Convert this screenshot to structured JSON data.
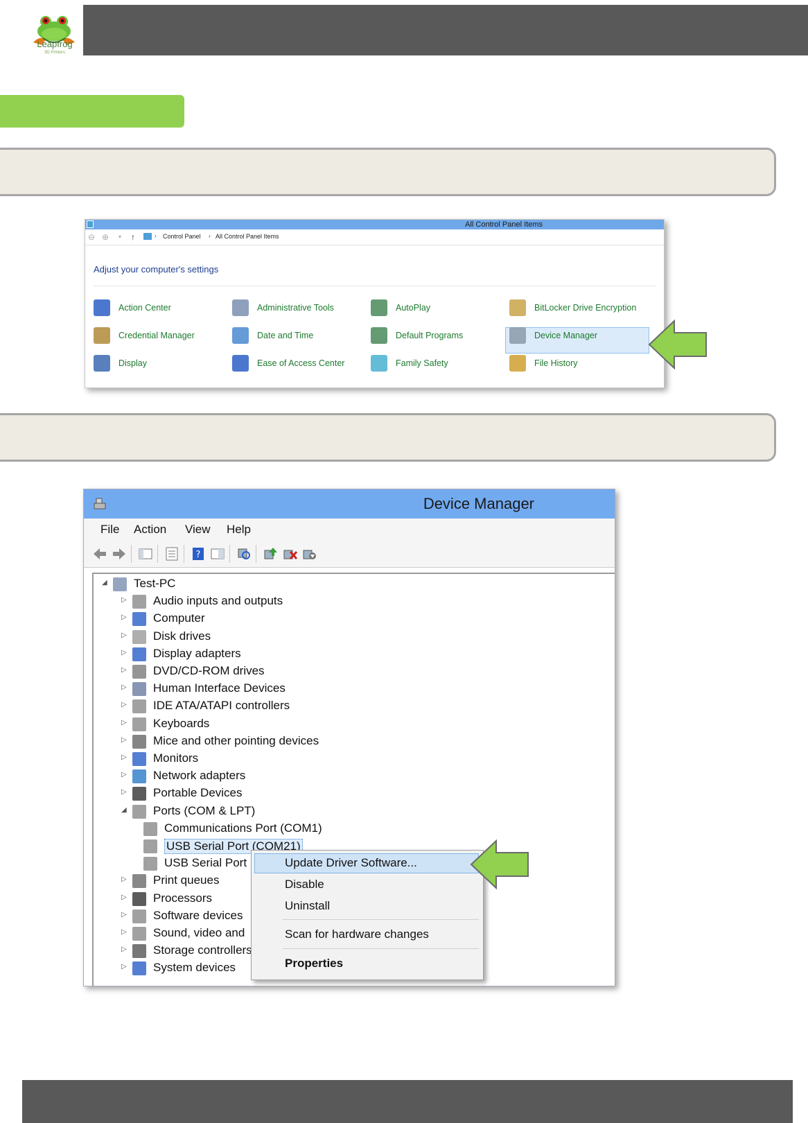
{
  "brand": {
    "name": "Leapfrog",
    "sub": "3D Printers"
  },
  "control_panel": {
    "title": "All Control Panel Items",
    "breadcrumb": [
      "Control Panel",
      "All Control Panel Items"
    ],
    "heading": "Adjust your computer's settings",
    "items": [
      {
        "label": "Action Center",
        "icon": "flag-icon"
      },
      {
        "label": "Administrative Tools",
        "icon": "admin-tools-icon"
      },
      {
        "label": "AutoPlay",
        "icon": "autoplay-icon"
      },
      {
        "label": "BitLocker Drive Encryption",
        "icon": "bitlocker-icon"
      },
      {
        "label": "Credential Manager",
        "icon": "credential-icon"
      },
      {
        "label": "Date and Time",
        "icon": "clock-icon"
      },
      {
        "label": "Default Programs",
        "icon": "default-programs-icon"
      },
      {
        "label": "Device Manager",
        "icon": "device-manager-icon"
      },
      {
        "label": "Display",
        "icon": "display-icon"
      },
      {
        "label": "Ease of Access Center",
        "icon": "ease-access-icon"
      },
      {
        "label": "Family Safety",
        "icon": "family-icon"
      },
      {
        "label": "File History",
        "icon": "file-history-icon"
      }
    ],
    "selected": "Device Manager"
  },
  "device_manager": {
    "title": "Device Manager",
    "menu": [
      "File",
      "Action",
      "View",
      "Help"
    ],
    "tree": [
      {
        "label": "Test-PC",
        "state": "expanded"
      },
      {
        "label": "Audio inputs and outputs",
        "state": "collapsed"
      },
      {
        "label": "Computer",
        "state": "collapsed"
      },
      {
        "label": "Disk drives",
        "state": "collapsed"
      },
      {
        "label": "Display adapters",
        "state": "collapsed"
      },
      {
        "label": "DVD/CD-ROM drives",
        "state": "collapsed"
      },
      {
        "label": "Human Interface Devices",
        "state": "collapsed"
      },
      {
        "label": "IDE ATA/ATAPI controllers",
        "state": "collapsed"
      },
      {
        "label": "Keyboards",
        "state": "collapsed"
      },
      {
        "label": "Mice and other pointing devices",
        "state": "collapsed"
      },
      {
        "label": "Monitors",
        "state": "collapsed"
      },
      {
        "label": "Network adapters",
        "state": "collapsed"
      },
      {
        "label": "Portable Devices",
        "state": "collapsed"
      },
      {
        "label": "Ports (COM & LPT)",
        "state": "expanded"
      },
      {
        "label": "Communications Port (COM1)",
        "state": "leaf"
      },
      {
        "label": "USB Serial Port (COM21)",
        "state": "leaf"
      },
      {
        "label": "USB Serial Port",
        "state": "leaf"
      },
      {
        "label": "Print queues",
        "state": "collapsed"
      },
      {
        "label": "Processors",
        "state": "collapsed"
      },
      {
        "label": "Software devices",
        "state": "collapsed"
      },
      {
        "label": "Sound, video and",
        "state": "collapsed"
      },
      {
        "label": "Storage controllers",
        "state": "collapsed"
      },
      {
        "label": "System devices",
        "state": "collapsed"
      }
    ],
    "context_menu": [
      "Update Driver Software...",
      "Disable",
      "Uninstall",
      "Scan for hardware changes",
      "Properties"
    ]
  },
  "colors": {
    "header": "#595959",
    "accent_green": "#92d050",
    "step_box": "#edebe2",
    "link_green": "#1d7a2e",
    "title_blue": "#72aaf0"
  }
}
